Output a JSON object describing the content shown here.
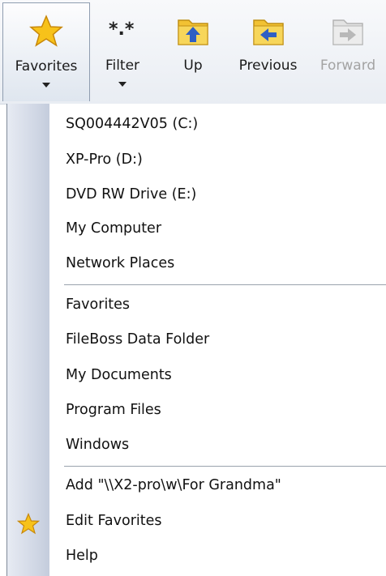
{
  "toolbar": {
    "buttons": [
      {
        "label": "Favorites",
        "icon": "star-icon",
        "has_dropdown": true,
        "active": true
      },
      {
        "label": "Filter",
        "icon": "filter-icon",
        "has_dropdown": true
      },
      {
        "label": "Up",
        "icon": "folder-up-icon"
      },
      {
        "label": "Previous",
        "icon": "folder-back-icon"
      },
      {
        "label": "Forward",
        "icon": "folder-forward-icon",
        "disabled": true
      }
    ]
  },
  "menu": {
    "drives": [
      {
        "label": "SQ004442V05 (C:)"
      },
      {
        "label": "XP-Pro (D:)"
      },
      {
        "label": "DVD RW Drive (E:)"
      },
      {
        "label": "My Computer"
      },
      {
        "label": "Network Places"
      }
    ],
    "folders": [
      {
        "label": "Favorites"
      },
      {
        "label": "FileBoss Data Folder"
      },
      {
        "label": "My Documents"
      },
      {
        "label": "Program Files"
      },
      {
        "label": "Windows"
      }
    ],
    "actions": [
      {
        "label": "Add \"\\\\X2-pro\\w\\For Grandma\""
      },
      {
        "label": "Edit Favorites",
        "icon": "star-icon"
      },
      {
        "label": "Help"
      }
    ]
  },
  "colors": {
    "star_fill": "#f7c21a",
    "folder_fill": "#f2c233",
    "arrow_blue": "#2f5fc4",
    "disabled_gray": "#a3a3a3"
  }
}
